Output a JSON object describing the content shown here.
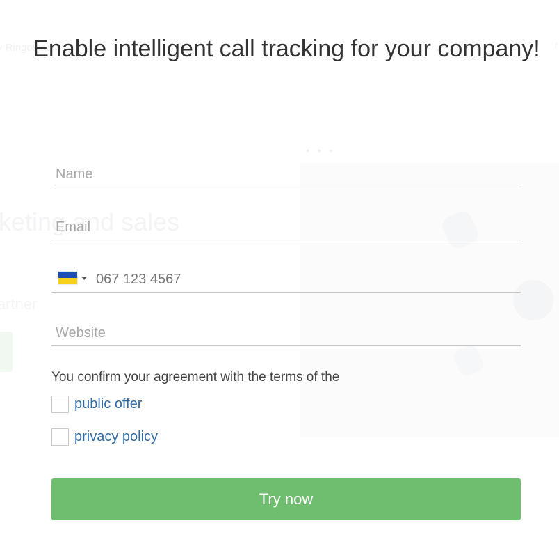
{
  "modal": {
    "title": "Enable intelligent call tracking for your company!"
  },
  "form": {
    "name_placeholder": "Name",
    "email_placeholder": "Email",
    "phone": {
      "country_flag": "ua-flag-icon",
      "value": "067 123 4567"
    },
    "website_placeholder": "Website",
    "agreement_text": "You confirm your agreement with the terms of the",
    "links": {
      "public_offer": "public offer",
      "privacy_policy": "privacy policy"
    },
    "checkboxes": {
      "public_offer_checked": false,
      "privacy_policy_checked": false
    },
    "submit_label": "Try now"
  },
  "background": {
    "nav_text": "y Ringostat f",
    "heading_fragment": "rketing and sales",
    "subtext_fragment": "artner",
    "dots": "• • •"
  },
  "colors": {
    "submit_button": "#6fbe70",
    "link": "#2f6aa5",
    "title_text": "#333333",
    "flag_blue": "#1d4fb5",
    "flag_yellow": "#f6d21a"
  }
}
